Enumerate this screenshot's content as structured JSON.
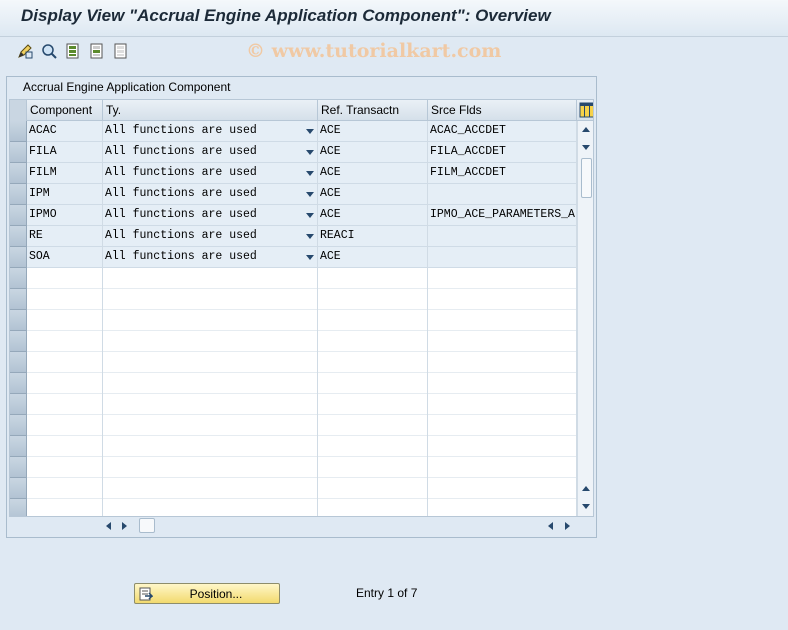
{
  "window": {
    "title": "Display View \"Accrual Engine Application Component\": Overview",
    "watermark": "© www.tutorialkart.com"
  },
  "toolbar": {
    "icons": [
      "change-display-icon",
      "detail-view-icon",
      "select-all-icon",
      "select-block-icon",
      "deselect-all-icon"
    ]
  },
  "panel": {
    "title": "Accrual Engine Application Component",
    "columns": [
      "Component",
      "Ty.",
      "Ref. Transactn",
      "Srce Flds"
    ],
    "rows": [
      {
        "component": "ACAC",
        "type": "All functions are used",
        "ref": "ACE",
        "src": "ACAC_ACCDET"
      },
      {
        "component": "FILA",
        "type": "All functions are used",
        "ref": "ACE",
        "src": "FILA_ACCDET"
      },
      {
        "component": "FILM",
        "type": "All functions are used",
        "ref": "ACE",
        "src": "FILM_ACCDET"
      },
      {
        "component": "IPM",
        "type": "All functions are used",
        "ref": "ACE",
        "src": ""
      },
      {
        "component": "IPMO",
        "type": "All functions are used",
        "ref": "ACE",
        "src": "IPMO_ACE_PARAMETERS_A"
      },
      {
        "component": "RE",
        "type": "All functions are used",
        "ref": "REACI",
        "src": ""
      },
      {
        "component": "SOA",
        "type": "All functions are used",
        "ref": "ACE",
        "src": ""
      }
    ]
  },
  "footer": {
    "position_label": "Position...",
    "entry_text": "Entry 1 of 7"
  },
  "colors": {
    "background": "#dfe9f3",
    "filled_row": "#e5eef6",
    "button_yellow": "#f2da6e"
  }
}
